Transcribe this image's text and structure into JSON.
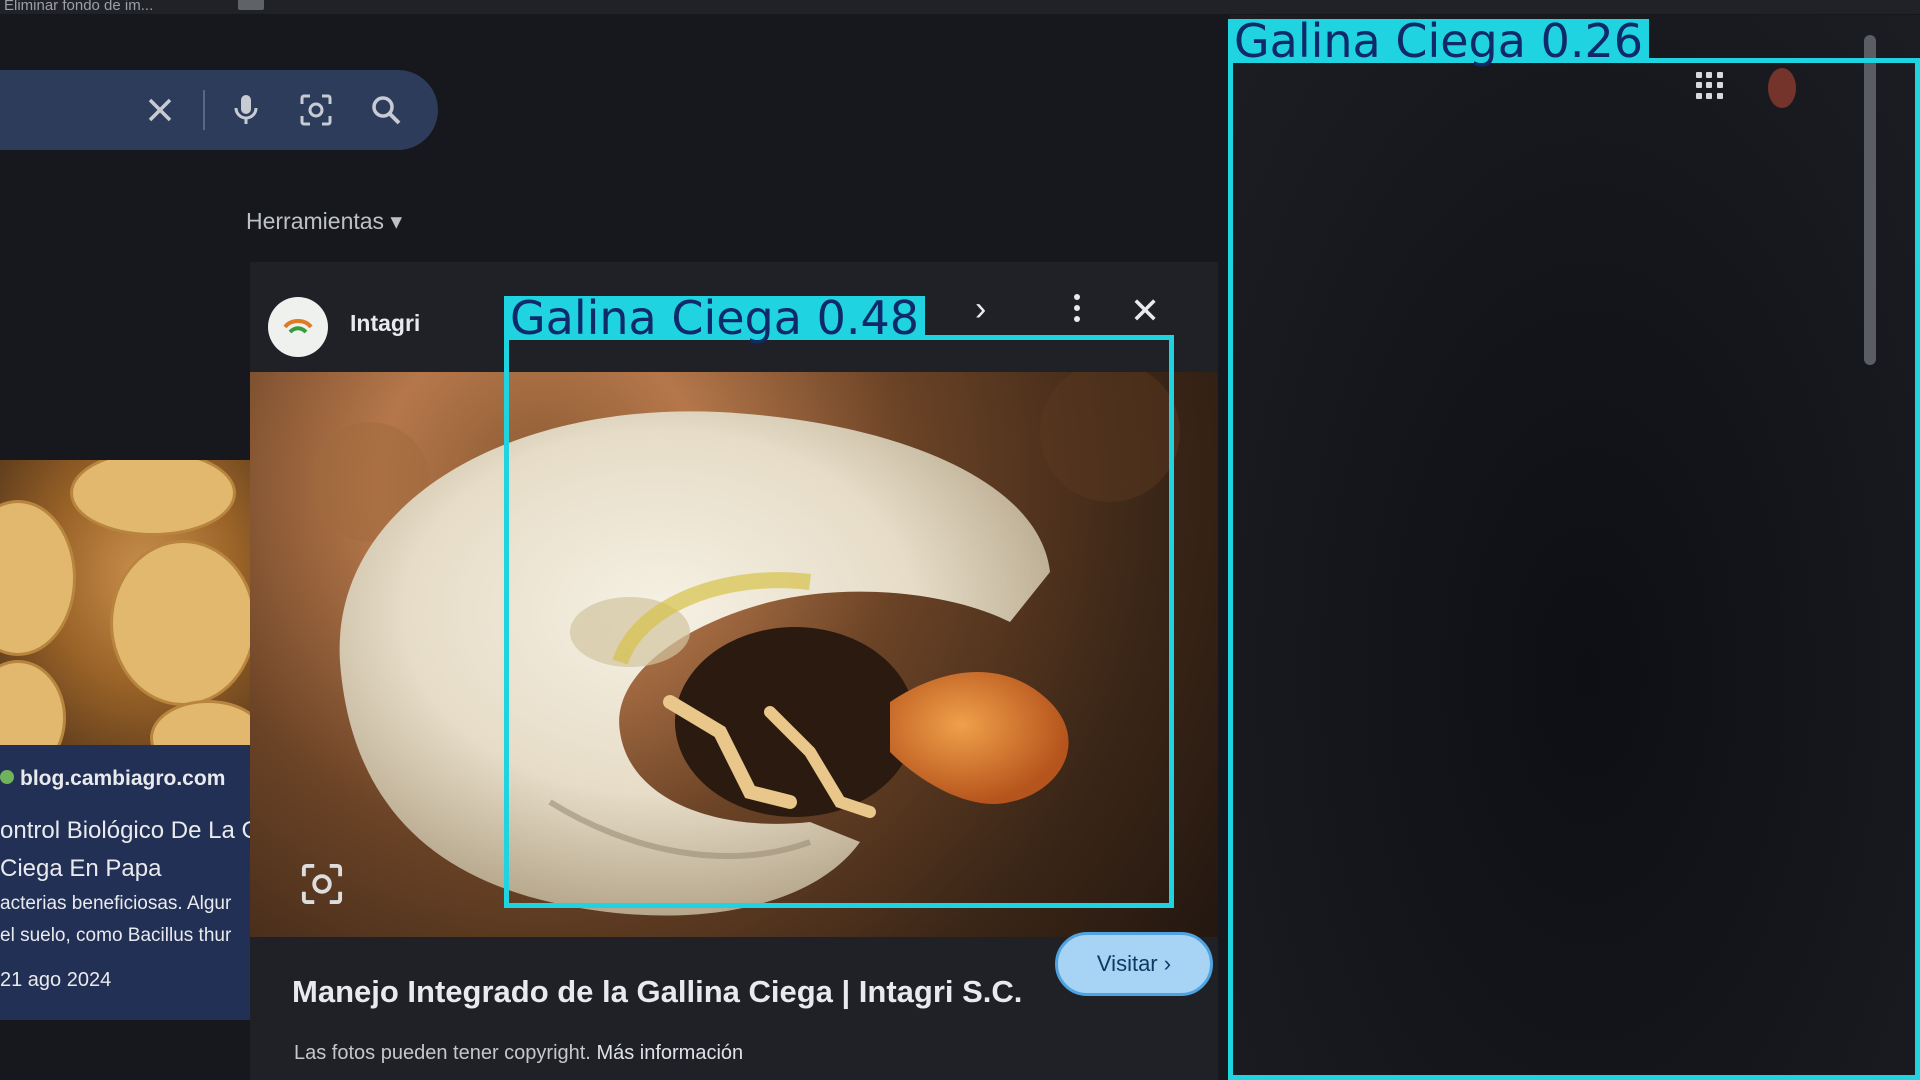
{
  "browser": {
    "tab_title": "Eliminar fondo de im..."
  },
  "search_bar": {
    "icons": [
      "close-icon",
      "mic-icon",
      "lens-icon",
      "search-icon"
    ]
  },
  "toolbar": {
    "tools_label": "Herramientas"
  },
  "left_result": {
    "source": "blog.cambiagro.com",
    "title": "Control Biológico De La Gallina Ciega En Papa",
    "title_visible": "ontrol Biológico De La G\nCiega En Papa",
    "description": "Bacterias beneficiosas. Algunas bacterias del suelo, como Bacillus thuringiensis",
    "description_visible": "acterias beneficiosas. Algur\nel suelo, como Bacillus thur",
    "date": "21 ago 2024",
    "date_visible": "21 ago 2024"
  },
  "preview_panel": {
    "site_name": "Intagri",
    "next_icon": "chevron-right-icon",
    "more_icon": "more-vert-icon",
    "close_icon": "close-icon",
    "page_title": "Manejo Integrado de la Gallina Ciega | Intagri S.C.",
    "visit_label": "Visitar",
    "copyright_text": "Las fotos pueden tener copyright.",
    "more_info_link": "Más información"
  },
  "detections": [
    {
      "label": "Galina  Ciega  0.48",
      "class": "Galina Ciega",
      "confidence": 0.48
    },
    {
      "label": "Galina  Ciega  0.26",
      "class": "Galina Ciega",
      "confidence": 0.26
    }
  ],
  "colors": {
    "bbox": "#1fd3e0",
    "bbox_text": "#0f2a66",
    "search_bar": "#2e3c5c",
    "visit_button": "#a7d3f5"
  }
}
